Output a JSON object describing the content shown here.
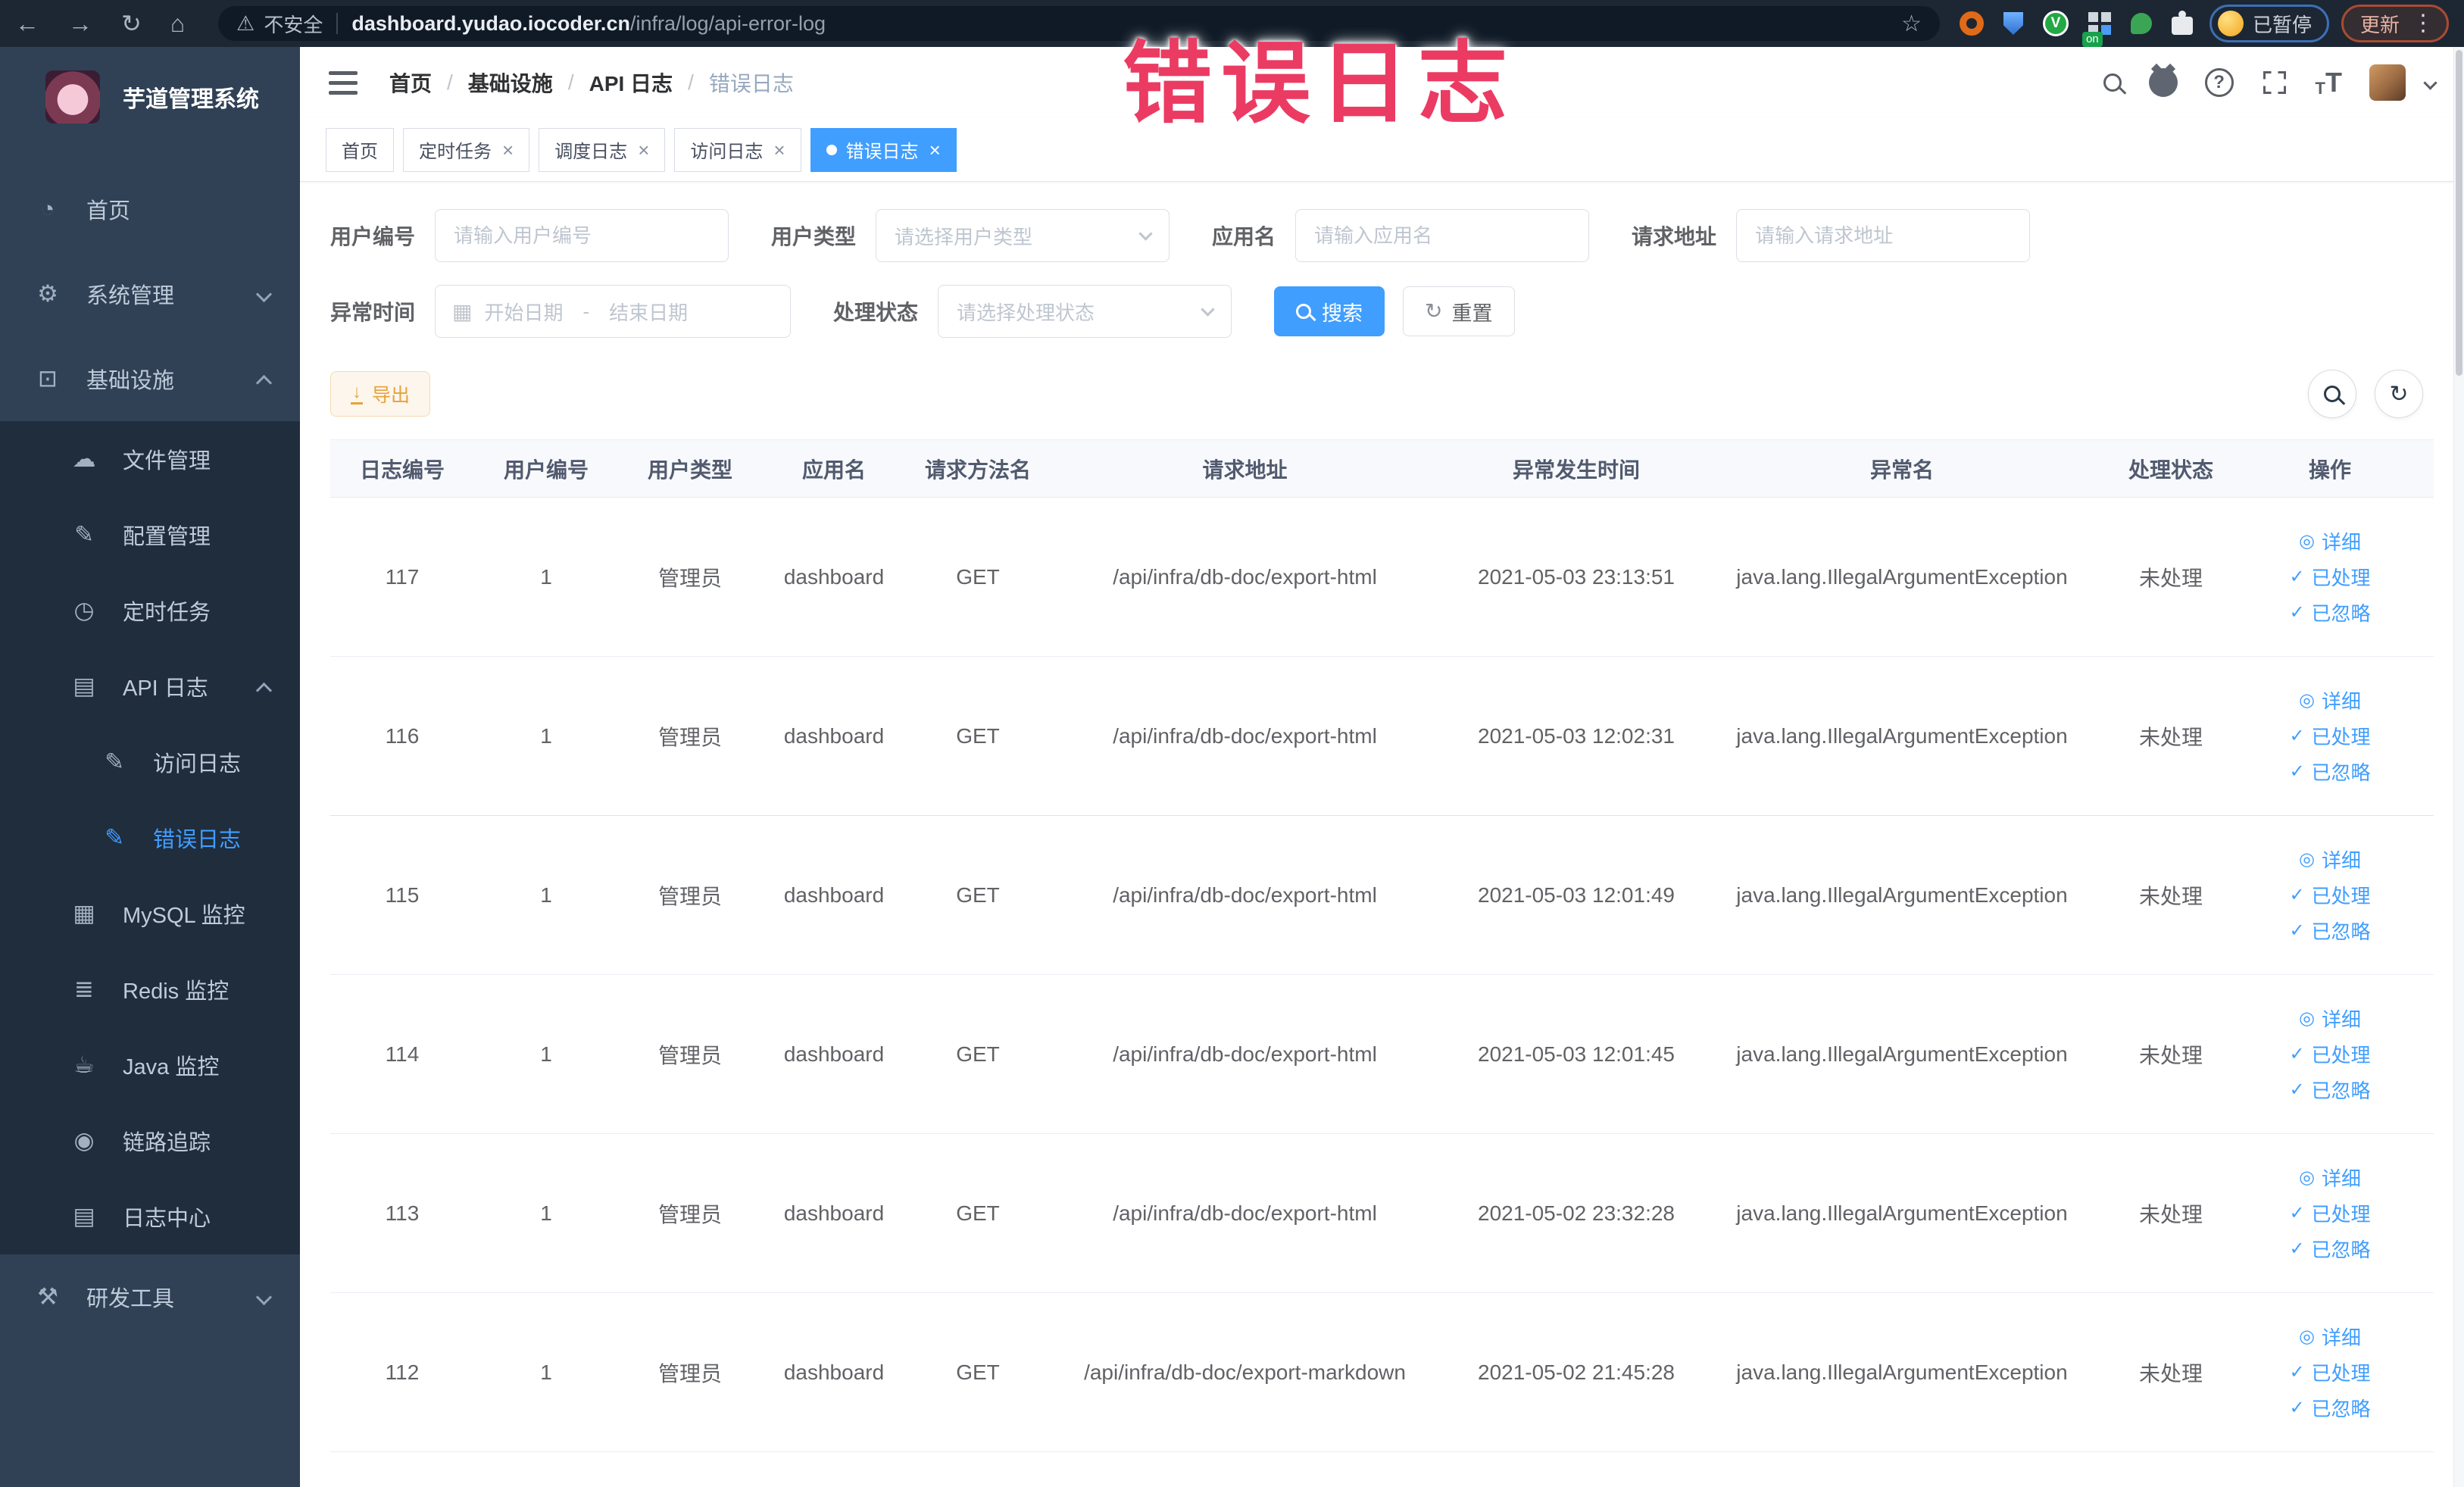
{
  "browser": {
    "nav_icons": [
      "back-arrow",
      "forward-arrow",
      "reload",
      "home"
    ],
    "security_label": "不安全",
    "url_host": "dashboard.yudao.iocoder.cn",
    "url_path": "/infra/log/api-error-log",
    "extension_badge": "on",
    "paused_label": "已暂停",
    "update_label": "更新"
  },
  "annotation": {
    "text": "错误日志",
    "color": "#eb3b63"
  },
  "sidebar": {
    "title": "芋道管理系统",
    "items": [
      {
        "label": "首页",
        "icon": "dashboard-icon",
        "level": 0
      },
      {
        "label": "系统管理",
        "icon": "gear-icon",
        "level": 0,
        "chevron": "down"
      },
      {
        "label": "基础设施",
        "icon": "monitor-icon",
        "level": 0,
        "chevron": "up"
      },
      {
        "label": "文件管理",
        "icon": "cloud-icon",
        "level": 1
      },
      {
        "label": "配置管理",
        "icon": "edit-icon",
        "level": 1
      },
      {
        "label": "定时任务",
        "icon": "timer-icon",
        "level": 1
      },
      {
        "label": "API 日志",
        "icon": "log-icon",
        "level": 1,
        "chevron": "up"
      },
      {
        "label": "访问日志",
        "icon": "doc-edit-icon",
        "level": 2
      },
      {
        "label": "错误日志",
        "icon": "doc-edit-icon",
        "level": 2,
        "active": true
      },
      {
        "label": "MySQL 监控",
        "icon": "chart-icon",
        "level": 1
      },
      {
        "label": "Redis 监控",
        "icon": "layers-icon",
        "level": 1
      },
      {
        "label": "Java 监控",
        "icon": "coffee-icon",
        "level": 1
      },
      {
        "label": "链路追踪",
        "icon": "eye-icon",
        "level": 1
      },
      {
        "label": "日志中心",
        "icon": "doc-icon",
        "level": 1
      },
      {
        "label": "研发工具",
        "icon": "tools-icon",
        "level": 0,
        "chevron": "down"
      }
    ]
  },
  "navbar": {
    "breadcrumb": [
      "首页",
      "基础设施",
      "API 日志",
      "错误日志"
    ],
    "icons": [
      "search-icon",
      "github-icon",
      "help-icon",
      "fullscreen-icon",
      "font-size-icon",
      "user-avatar",
      "caret-down-icon"
    ]
  },
  "tabs": [
    {
      "label": "首页",
      "closable": false,
      "active": false
    },
    {
      "label": "定时任务",
      "closable": true,
      "active": false
    },
    {
      "label": "调度日志",
      "closable": true,
      "active": false
    },
    {
      "label": "访问日志",
      "closable": true,
      "active": false
    },
    {
      "label": "错误日志",
      "closable": true,
      "active": true
    }
  ],
  "filter": {
    "user_id": {
      "label": "用户编号",
      "placeholder": "请输入用户编号"
    },
    "user_type": {
      "label": "用户类型",
      "placeholder": "请选择用户类型"
    },
    "app_name": {
      "label": "应用名",
      "placeholder": "请输入应用名"
    },
    "request_url": {
      "label": "请求地址",
      "placeholder": "请输入请求地址"
    },
    "exception_time": {
      "label": "异常时间",
      "start_placeholder": "开始日期",
      "separator": "-",
      "end_placeholder": "结束日期"
    },
    "process_status": {
      "label": "处理状态",
      "placeholder": "请选择处理状态"
    },
    "search_label": "搜索",
    "reset_label": "重置"
  },
  "toolbar": {
    "export_label": "导出"
  },
  "table": {
    "columns": [
      "日志编号",
      "用户编号",
      "用户类型",
      "应用名",
      "请求方法名",
      "请求地址",
      "异常发生时间",
      "异常名",
      "处理状态",
      "操作"
    ],
    "ops": [
      "详细",
      "已处理",
      "已忽略"
    ],
    "rows": [
      {
        "id": "117",
        "user_id": "1",
        "user_type": "管理员",
        "app": "dashboard",
        "method": "GET",
        "url": "/api/infra/db-doc/export-html",
        "time": "2021-05-03 23:13:51",
        "exception": "java.lang.IllegalArgumentException",
        "status": "未处理"
      },
      {
        "id": "116",
        "user_id": "1",
        "user_type": "管理员",
        "app": "dashboard",
        "method": "GET",
        "url": "/api/infra/db-doc/export-html",
        "time": "2021-05-03 12:02:31",
        "exception": "java.lang.IllegalArgumentException",
        "status": "未处理"
      },
      {
        "id": "115",
        "user_id": "1",
        "user_type": "管理员",
        "app": "dashboard",
        "method": "GET",
        "url": "/api/infra/db-doc/export-html",
        "time": "2021-05-03 12:01:49",
        "exception": "java.lang.IllegalArgumentException",
        "status": "未处理"
      },
      {
        "id": "114",
        "user_id": "1",
        "user_type": "管理员",
        "app": "dashboard",
        "method": "GET",
        "url": "/api/infra/db-doc/export-html",
        "time": "2021-05-03 12:01:45",
        "exception": "java.lang.IllegalArgumentException",
        "status": "未处理"
      },
      {
        "id": "113",
        "user_id": "1",
        "user_type": "管理员",
        "app": "dashboard",
        "method": "GET",
        "url": "/api/infra/db-doc/export-html",
        "time": "2021-05-02 23:32:28",
        "exception": "java.lang.IllegalArgumentException",
        "status": "未处理"
      },
      {
        "id": "112",
        "user_id": "1",
        "user_type": "管理员",
        "app": "dashboard",
        "method": "GET",
        "url": "/api/infra/db-doc/export-markdown",
        "time": "2021-05-02 21:45:28",
        "exception": "java.lang.IllegalArgumentException",
        "status": "未处理"
      }
    ]
  }
}
